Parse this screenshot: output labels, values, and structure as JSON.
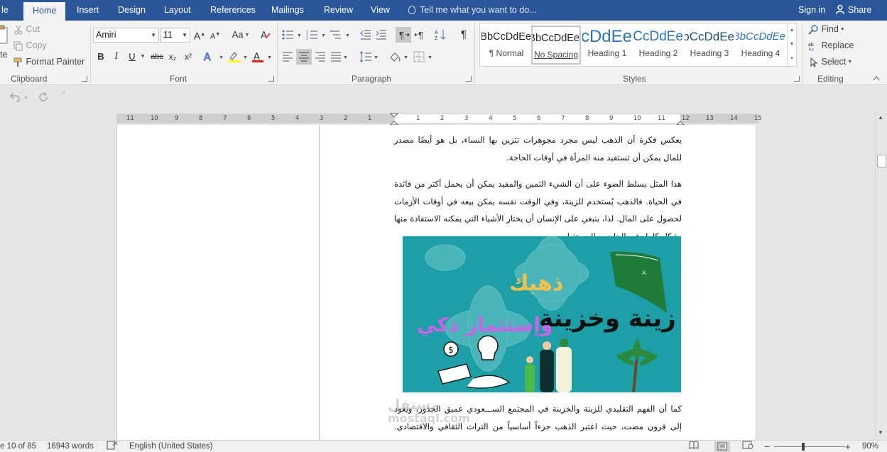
{
  "tabs": {
    "file_partial": "le",
    "home": "Home",
    "insert": "Insert",
    "design": "Design",
    "layout": "Layout",
    "references": "References",
    "mailings": "Mailings",
    "review": "Review",
    "view": "View",
    "tell_me": "Tell me what you want to do...",
    "sign_in": "Sign in",
    "share": "Share"
  },
  "clipboard": {
    "cut": "Cut",
    "copy": "Copy",
    "paste_partial": "te",
    "format_painter": "Format Painter",
    "label": "Clipboard"
  },
  "font": {
    "name": "Amiri",
    "size": "11",
    "bold": "B",
    "italic": "I",
    "underline": "U",
    "strike": "abc",
    "subscript": "x₂",
    "superscript": "x²",
    "grow": "A",
    "shrink": "A",
    "change_case": "Aa",
    "label": "Font"
  },
  "paragraph": {
    "label": "Paragraph",
    "pilcrow": "¶"
  },
  "styles": {
    "label": "Styles",
    "items": [
      {
        "sample": "AaBbCcDdEe",
        "name": "¶ Normal"
      },
      {
        "sample": "AaBbCcDdEe",
        "name": "No Spacing"
      },
      {
        "sample": "AaBbCcDdEe",
        "name": "Heading 1"
      },
      {
        "sample": "AaBbCcDdEe",
        "name": "Heading 2"
      },
      {
        "sample": "AaBbCcDdEe",
        "name": "Heading 3"
      },
      {
        "sample": "AaBbCcDdEe",
        "name": "Heading 4"
      }
    ]
  },
  "editing": {
    "find": "Find",
    "replace": "Replace",
    "select": "Select",
    "label": "Editing"
  },
  "ruler": {
    "left_numbers": [
      "11",
      "10",
      "9",
      "8",
      "7",
      "6",
      "5",
      "4",
      "3",
      "2",
      "1"
    ],
    "right_numbers": [
      "1",
      "2",
      "3",
      "4",
      "5",
      "6",
      "7",
      "8",
      "9",
      "10",
      "11",
      "12",
      "13",
      "14",
      "15"
    ]
  },
  "document": {
    "para1": "يعكس فكرة أن الذهب ليس مجرد مجوهرات تتزين بها النساء، بل هو أيضًا مصدر للمال يمكن أن تستفيد منه المرأة في أوقات الحاجة.",
    "para2": "هذا المثل يسلط الضوء على أن الشيء الثمين والمفيد يمكن أن يحمل أكثر من فائدة في الحياة. فالذهب يُستخدم للزينة، وفي الوقت نفسه يمكن بيعه في أوقات الأزمات لحصول على المال. لذا، ينبغي على الإنسان أن يختار الأشياء التي يمكنه الاستفادة منها بشكل كامل في الحاضر والمستقبل.",
    "para3": "كما أن الفهم التقليدي للزينة والخزينة في المجتمع الســـعودي عميق الجذور، ويعود إلى قرون مضت، حيث اعتبر الذهب جزءاً أساسياً من التراث الثقافي والاقتصادي. المقولة الشائعة \"الذهب",
    "image_title1": "ذهبك",
    "image_title2": "زينة وخزينة",
    "image_title3": "وإستثمار ذكي",
    "watermark": "مستقل",
    "watermark2": "mostaql.com"
  },
  "status": {
    "page": "e 10 of 85",
    "words": "16943 words",
    "language": "English (United States)",
    "zoom": "90%"
  },
  "colors": {
    "accent": "#2b579a",
    "image_bg": "#1c9fa6"
  }
}
